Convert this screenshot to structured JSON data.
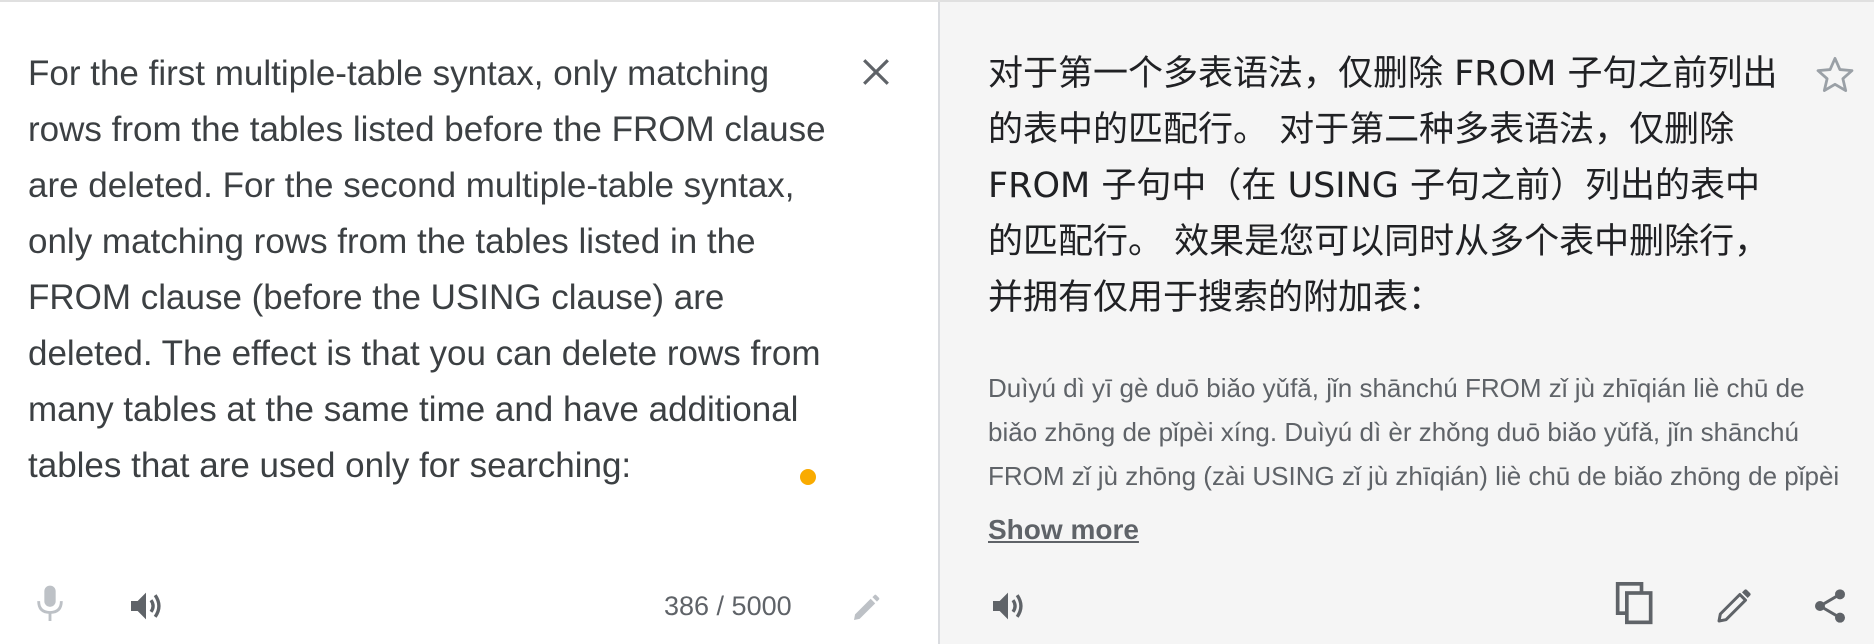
{
  "source": {
    "text": "For the first multiple-table syntax, only matching rows from the tables listed before the FROM clause are deleted. For the second multiple-table syntax, only matching rows from the tables listed in the FROM clause (before the USING clause) are deleted. The effect is that you can delete rows from many tables at the same time and have additional tables that are used only for searching:",
    "char_count": "386 / 5000",
    "icons": {
      "clear": "close-icon",
      "mic": "microphone-icon",
      "listen": "speaker-icon",
      "handwrite": "pencil-icon"
    },
    "accent_color": "#f9ab00"
  },
  "target": {
    "text": "对于第一个多表语法，仅删除 FROM 子句之前列出的表中的匹配行。 对于第二种多表语法，仅删除 FROM 子句中（在 USING 子句之前）列出的表中的匹配行。 效果是您可以同时从多个表中删除行，并拥有仅用于搜索的附加表：",
    "romanization": "Duìyú dì yī gè duō biǎo yǔfǎ, jǐn shānchú FROM zǐ jù zhīqián liè chū de biǎo zhōng de pǐpèi xíng. Duìyú dì èr zhǒng duō biǎo yǔfǎ, jǐn shānchú FROM zǐ jù zhōng (zài USING zǐ jù zhīqián) liè chū de biǎo zhōng de pǐpèi xíng. Xiàoguǒ shì nín kěyǐ tóngshí cóng duō gè biǎo zhōng shānchú xíng, bìng yǒngyǒu jǐn yòng yú sōusuǒ de fùjiā biǎo:",
    "show_more_label": "Show more",
    "icons": {
      "star": "star-icon",
      "listen": "speaker-icon",
      "copy": "copy-icon",
      "edit": "pencil-icon",
      "share": "share-icon"
    }
  }
}
